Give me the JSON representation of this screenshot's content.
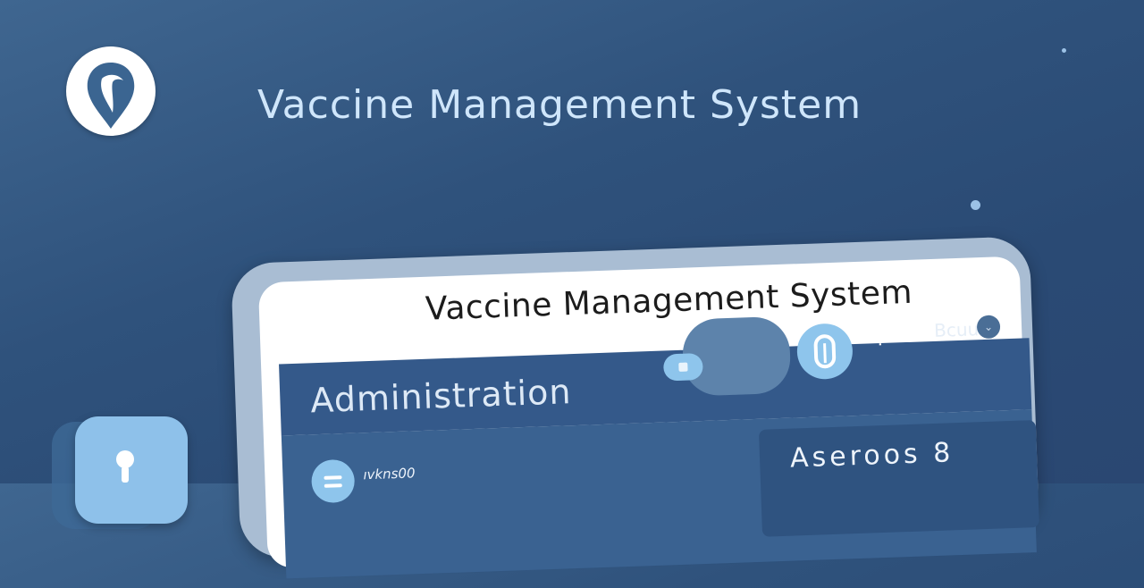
{
  "header": {
    "title": "Vaccine Management System",
    "logo_icon": "shield-drop-icon"
  },
  "app": {
    "title": "Vaccine Management System",
    "section_title": "Administration",
    "toolbar": {
      "pill_icon": "square-icon",
      "avatar_icon": "profile-icon",
      "menu_icon": "grid-dots-icon",
      "menu_symbol": "⁘",
      "user_label": "Bcuu",
      "caret_symbol": "⌄"
    },
    "list": {
      "row_icon": "list-icon",
      "row_label": "ıvkns00"
    },
    "stat_card": {
      "label": "Aseroos 8"
    }
  },
  "side_card": {
    "icon": "person-icon"
  },
  "colors": {
    "background": "#2f527c",
    "accent": "#8ec5ec",
    "header_bar": "#34598a",
    "title_text": "#cfe6fb"
  }
}
